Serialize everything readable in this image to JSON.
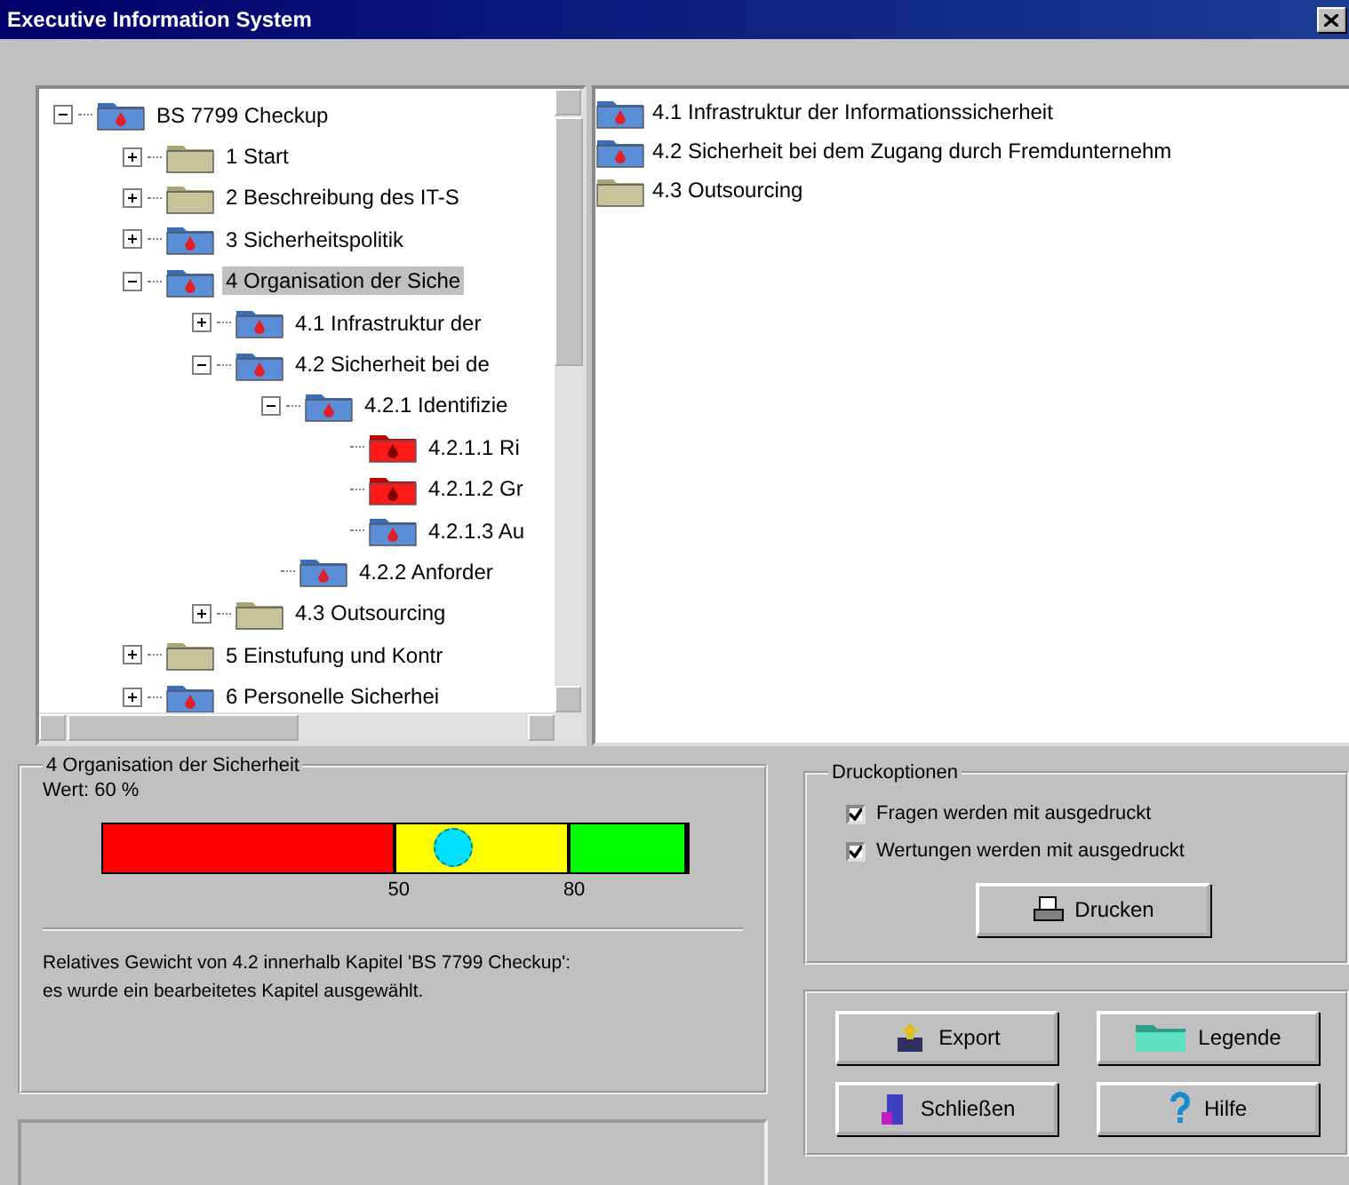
{
  "window": {
    "title": "Executive Information System"
  },
  "tree": [
    {
      "label": "BS 7799 Checkup",
      "kind": "rated",
      "expanded": true,
      "selected": false,
      "children": [
        {
          "label": "1 Start",
          "kind": "plain",
          "expanded": false,
          "selected": false
        },
        {
          "label": "2 Beschreibung des IT-S",
          "kind": "plain",
          "expanded": false,
          "selected": false
        },
        {
          "label": "3 Sicherheitspolitik",
          "kind": "rated",
          "expanded": false,
          "selected": false
        },
        {
          "label": "4 Organisation der Siche",
          "kind": "rated",
          "expanded": true,
          "selected": true,
          "children": [
            {
              "label": "4.1 Infrastruktur der",
              "kind": "rated",
              "expanded": false,
              "selected": false
            },
            {
              "label": "4.2 Sicherheit bei de",
              "kind": "rated",
              "expanded": true,
              "selected": false,
              "children": [
                {
                  "label": "4.2.1 Identifizie",
                  "kind": "rated",
                  "expanded": true,
                  "selected": false,
                  "children": [
                    {
                      "label": "4.2.1.1 Ri",
                      "kind": "critical",
                      "selected": false
                    },
                    {
                      "label": "4.2.1.2 Gr",
                      "kind": "critical",
                      "selected": false
                    },
                    {
                      "label": "4.2.1.3 Au",
                      "kind": "rated",
                      "selected": false
                    }
                  ]
                },
                {
                  "label": "4.2.2 Anforder",
                  "kind": "rated",
                  "selected": false
                }
              ]
            },
            {
              "label": "4.3 Outsourcing",
              "kind": "plain",
              "expanded": false,
              "selected": false
            }
          ]
        },
        {
          "label": "5 Einstufung und Kontr",
          "kind": "plain",
          "expanded": false,
          "selected": false
        },
        {
          "label": "6 Personelle Sicherhei",
          "kind": "rated",
          "expanded": false,
          "selected": false
        }
      ]
    }
  ],
  "list": [
    {
      "label": "4.1 Infrastruktur der Informationssicherheit",
      "kind": "rated"
    },
    {
      "label": "4.2 Sicherheit bei dem Zugang durch Fremdunternehm",
      "kind": "rated"
    },
    {
      "label": "4.3 Outsourcing",
      "kind": "plain"
    }
  ],
  "rating": {
    "title": "4 Organisation der Sicherheit",
    "value": "Wert: 60 %",
    "level": 0.6,
    "segments": [
      {
        "color": "#ff0000",
        "tick": "50"
      },
      {
        "color": "#ffff00",
        "tick": "80"
      },
      {
        "color": "#00ff00"
      }
    ],
    "note": "Relatives Gewicht von 4.2 innerhalb Kapitel 'BS 7799 Checkup':\nes wurde ein bearbeitetes Kapitel ausgewählt."
  },
  "print_options": {
    "title": "Druckoptionen",
    "options": [
      {
        "label": "Fragen werden mit ausgedruckt",
        "checked": true
      },
      {
        "label": "Wertungen werden mit ausgedruckt",
        "checked": true
      }
    ],
    "button": "Drucken"
  },
  "buttons": [
    {
      "label": "Export",
      "kind": "export"
    },
    {
      "label": "Legende",
      "kind": "legend"
    },
    {
      "label": "Schließen",
      "kind": "close"
    },
    {
      "label": "Hilfe",
      "kind": "help"
    }
  ]
}
